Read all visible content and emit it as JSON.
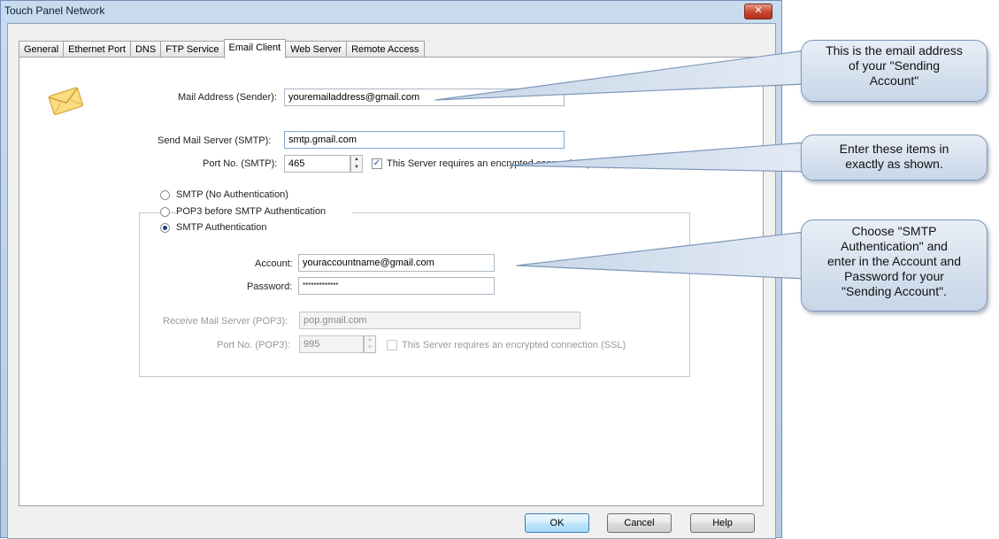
{
  "window": {
    "title": "Touch Panel Network",
    "close_glyph": "✕"
  },
  "tabs": [
    {
      "label": "General"
    },
    {
      "label": "Ethernet Port"
    },
    {
      "label": "DNS"
    },
    {
      "label": "FTP Service"
    },
    {
      "label": "Email Client"
    },
    {
      "label": "Web Server"
    },
    {
      "label": "Remote Access"
    }
  ],
  "active_tab": "Email Client",
  "form": {
    "mail_address_label": "Mail Address (Sender):",
    "mail_address_value": "youremailaddress@gmail.com",
    "smtp_server_label": "Send Mail Server (SMTP):",
    "smtp_server_value": "smtp.gmail.com",
    "smtp_port_label": "Port No. (SMTP):",
    "smtp_port_value": "465",
    "smtp_ssl_label": "This Server requires  an  encrypted  connection (SSL)",
    "smtp_ssl_checked": true,
    "radio_no_auth": "SMTP (No Authentication)",
    "radio_pop_before": "POP3 before SMTP Authentication",
    "radio_smtp_auth": "SMTP Authentication",
    "selected_auth": "SMTP Authentication",
    "account_label": "Account:",
    "account_value": "youraccountname@gmail.com",
    "password_label": "Password:",
    "password_value": "*************",
    "pop3_server_label": "Receive Mail Server (POP3):",
    "pop3_server_value": "pop.gmail.com",
    "pop3_port_label": "Port No. (POP3):",
    "pop3_port_value": "995",
    "pop3_ssl_label": "This Server requires  an  encrypted  connection (SSL)",
    "pop3_ssl_checked": false
  },
  "buttons": {
    "ok": "OK",
    "cancel": "Cancel",
    "help": "Help"
  },
  "callouts": {
    "email": {
      "line1": "This is the email address",
      "line2": "of your \"Sending",
      "line3": "Account\""
    },
    "enter": {
      "line1": "Enter these items in",
      "line2": "exactly as shown."
    },
    "auth": {
      "line1": "Choose \"SMTP",
      "line2": "Authentication\" and",
      "line3": "enter in the Account and",
      "line4": "Password for your",
      "line5": "\"Sending Account\"."
    }
  },
  "colors": {
    "title_bar": "#c9dbee",
    "close_button": "#c6452b",
    "callout_border": "#7d97b9",
    "default_button": "#bee6fd"
  }
}
